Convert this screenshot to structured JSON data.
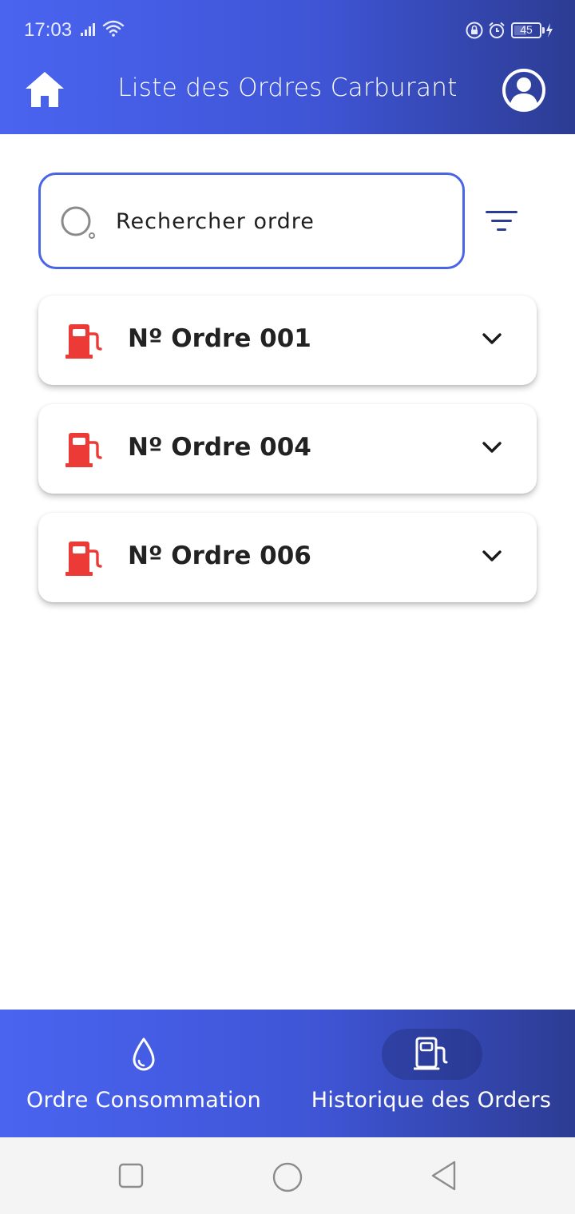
{
  "status_bar": {
    "time": "17:03",
    "battery_level": "45",
    "battery_fraction": 0.45,
    "icons": [
      "signal-icon",
      "wifi-icon",
      "lock-icon",
      "alarm-icon",
      "battery-icon",
      "charging-icon"
    ]
  },
  "header": {
    "title": "Liste des Ordres Carburant",
    "left_icon": "home-icon",
    "right_icon": "profile-icon"
  },
  "search": {
    "placeholder": "Rechercher ordre",
    "value": "",
    "icon": "search-icon",
    "filter_icon": "filter-icon"
  },
  "orders": [
    {
      "label": "Nº Ordre 001"
    },
    {
      "label": "Nº Ordre 004"
    },
    {
      "label": "Nº Ordre 006"
    }
  ],
  "order_icon": "fuel-pump-icon",
  "order_expand_icon": "chevron-down-icon",
  "bottom_nav": {
    "items": [
      {
        "label": "Ordre Consommation",
        "icon": "drop-icon",
        "active": false
      },
      {
        "label": "Historique des Orders",
        "icon": "fuel-pump-icon",
        "active": true
      }
    ]
  },
  "system_nav": {
    "icons": [
      "recent-apps-icon",
      "home-circle-icon",
      "back-icon"
    ]
  },
  "colors": {
    "header_gradient_start": "#4a64f0",
    "header_gradient_end": "#2c3c93",
    "search_border": "#4a64e6",
    "fuel_icon": "#ec3b36",
    "text_dark": "#222222",
    "system_nav_bg": "#f4f4f4"
  }
}
